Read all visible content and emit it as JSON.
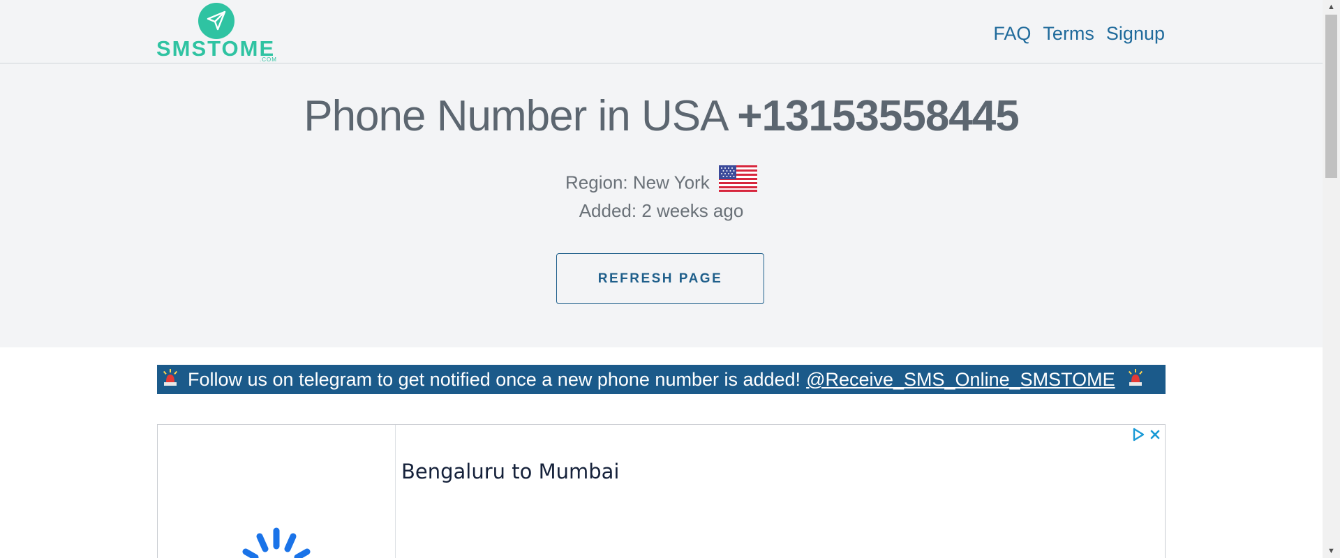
{
  "brand": {
    "name": "SMSTOME",
    "sub": ".COM"
  },
  "nav": [
    {
      "label": "FAQ"
    },
    {
      "label": "Terms"
    },
    {
      "label": "Signup"
    }
  ],
  "hero": {
    "title_prefix": "Phone Number in USA",
    "number": "+13153558445",
    "region": "Region: New York",
    "added": "Added: 2 weeks ago",
    "refresh_label": "REFRESH PAGE"
  },
  "banner": {
    "text": "Follow us on telegram to get notified once a new phone number is added!",
    "link": "@Receive_SMS_Online_SMSTOME"
  },
  "ad": {
    "title": "Bengaluru to Mumbai"
  },
  "colors": {
    "brand_teal": "#2fc3a2",
    "link_blue": "#1f6a9b",
    "banner_bg": "#1b5a8a",
    "hero_bg": "#f3f4f6"
  },
  "icons": [
    "paper-plane-icon",
    "us-flag-icon",
    "siren-icon",
    "ad-choices-icon",
    "close-icon",
    "loading-spinner-icon"
  ]
}
